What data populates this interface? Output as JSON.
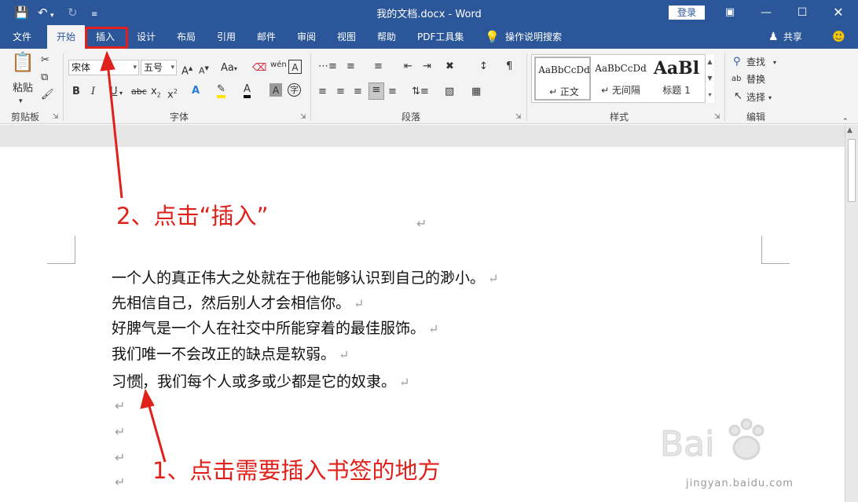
{
  "window": {
    "title": "我的文档.docx  -  Word",
    "login_label": "登录"
  },
  "tabs": [
    {
      "label": "文件"
    },
    {
      "label": "开始"
    },
    {
      "label": "插入"
    },
    {
      "label": "设计"
    },
    {
      "label": "布局"
    },
    {
      "label": "引用"
    },
    {
      "label": "邮件"
    },
    {
      "label": "审阅"
    },
    {
      "label": "视图"
    },
    {
      "label": "帮助"
    },
    {
      "label": "PDF工具集"
    },
    {
      "label": "操作说明搜索"
    }
  ],
  "share_label": "共享",
  "ribbon": {
    "clipboard": {
      "paste_label": "粘贴",
      "group_label": "剪贴板"
    },
    "font": {
      "font_name": "宋体",
      "font_size": "五号",
      "group_label": "字体"
    },
    "paragraph": {
      "group_label": "段落"
    },
    "styles": {
      "group_label": "样式",
      "items": [
        {
          "sample": "AaBbCcDd",
          "name": "↵ 正文"
        },
        {
          "sample": "AaBbCcDd",
          "name": "↵ 无间隔"
        },
        {
          "sample": "AaBl",
          "name": "标题 1"
        }
      ]
    },
    "editing": {
      "find_label": "查找",
      "replace_label": "替换",
      "select_label": "选择",
      "group_label": "编辑"
    }
  },
  "document": {
    "paragraphs": [
      "一个人的真正伟大之处就在于他能够认识到自己的渺小。",
      "先相信自己，然后别人才会相信你。",
      "好脾气是一个人在社交中所能穿着的最佳服饰。",
      "我们唯一不会改正的缺点是软弱。"
    ],
    "last_para_before": "习惯",
    "last_para_after": "，我们每个人或多或少都是它的奴隶。",
    "paragraph_mark": "↵"
  },
  "annotations": {
    "step1": "1、点击需要插入书签的地方",
    "step2": "2、点击“插入”"
  },
  "watermark": {
    "url": "jingyan.baidu.com"
  },
  "colors": {
    "titlebar": "#2b579a",
    "annotation": "#e0211b",
    "ribbon": "#f3f3f3"
  }
}
